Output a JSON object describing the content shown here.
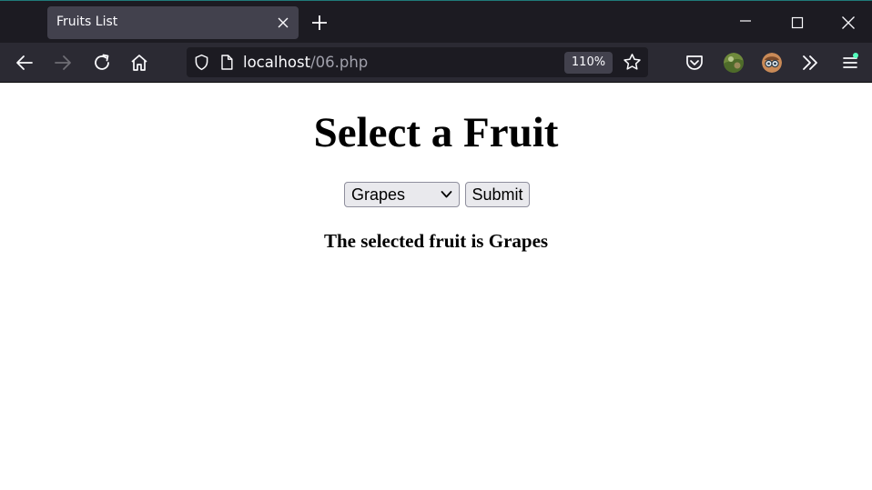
{
  "browser": {
    "tab": {
      "title": "Fruits List"
    },
    "url": {
      "host": "localhost",
      "path": "/06.php"
    },
    "zoom": "110%",
    "theme": {
      "titlebar": "#1c1b22",
      "tab_active": "#42414d",
      "toolbar": "#2b2a33",
      "urlbar": "#1c1b22",
      "notification_dot": "#54ffbd"
    },
    "icons": [
      "close-icon",
      "plus-icon",
      "minimize-icon",
      "maximize-icon",
      "window-close-icon",
      "back-arrow-icon",
      "forward-arrow-icon",
      "reload-icon",
      "home-icon",
      "shield-icon",
      "page-icon",
      "star-icon",
      "pocket-icon",
      "extension-avatar-icon",
      "overflow-chevrons-icon",
      "hamburger-menu-icon"
    ]
  },
  "page": {
    "heading": "Select a Fruit",
    "select": {
      "selected": "Grapes"
    },
    "submit_label": "Submit",
    "result": "The selected fruit is Grapes"
  }
}
